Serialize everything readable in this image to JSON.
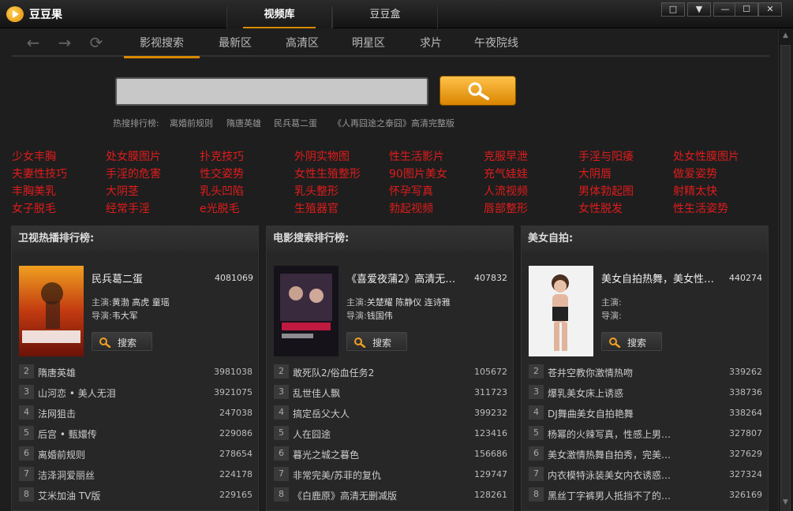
{
  "app": {
    "title": "豆豆果"
  },
  "top_tabs": [
    {
      "label": "视频库",
      "active": true
    },
    {
      "label": "豆豆盒",
      "active": false
    }
  ],
  "window_controls": {
    "skin": "□",
    "menu": "▼",
    "minimize": "—",
    "maximize": "☐",
    "close": "✕"
  },
  "nav": {
    "back": "←",
    "forward": "→",
    "refresh": "⟳",
    "tabs": [
      {
        "label": "影视搜索",
        "active": true
      },
      {
        "label": "最新区"
      },
      {
        "label": "高清区"
      },
      {
        "label": "明星区"
      },
      {
        "label": "求片"
      },
      {
        "label": "午夜院线"
      }
    ]
  },
  "search": {
    "value": "",
    "placeholder": ""
  },
  "hot_search": {
    "label": "热搜排行榜:",
    "items": [
      "离婚前规则",
      "隋唐英雄",
      "民兵葛二蛋",
      "《人再囧途之泰囧》高清完整版"
    ]
  },
  "tags": [
    [
      "少女丰胸",
      "处女膜图片",
      "扑克技巧",
      "外阴实物图",
      "性生活影片",
      "克服早泄",
      "手淫与阳痿",
      "处女性膜图片"
    ],
    [
      "夫妻性技巧",
      "手淫的危害",
      "性交姿势",
      "女性生殖整形",
      "90图片美女",
      "充气娃娃",
      "大阴唇",
      "做爱姿势"
    ],
    [
      "丰胸美乳",
      "大阴茎",
      "乳头凹陷",
      "乳头整形",
      "怀孕写真",
      "人流视频",
      "男体勃起图",
      "射精太快"
    ],
    [
      "女子脱毛",
      "经常手淫",
      "e光脱毛",
      "生殖器官",
      "勃起视频",
      "唇部整形",
      "女性脱发",
      "性生活姿势"
    ]
  ],
  "panels": [
    {
      "header": "卫视热播排行榜:",
      "featured": {
        "title": "民兵葛二蛋",
        "count": "4081069",
        "cast_label": "主演:",
        "cast": "黄渤  高虎  童瑶",
        "director_label": "导演:",
        "director": "韦大军",
        "search_label": "搜索"
      },
      "rows": [
        {
          "rank": "2",
          "title": "隋唐英雄",
          "count": "3981038"
        },
        {
          "rank": "3",
          "title": "山河恋 • 美人无泪",
          "count": "3921075"
        },
        {
          "rank": "4",
          "title": "法网狙击",
          "count": "247038"
        },
        {
          "rank": "5",
          "title": "后宫 • 甄嬛传",
          "count": "229086"
        },
        {
          "rank": "6",
          "title": "离婚前规则",
          "count": "278654"
        },
        {
          "rank": "7",
          "title": "洁泽洞爱丽丝",
          "count": "224178"
        },
        {
          "rank": "8",
          "title": "艾米加油  TV版",
          "count": "229165"
        }
      ]
    },
    {
      "header": "电影搜索排行榜:",
      "featured": {
        "title": "《喜爱夜蒲2》高清无…",
        "count": "407832",
        "cast_label": "主演:",
        "cast": "关楚耀  陈静仪  连诗雅",
        "director_label": "导演:",
        "director": "钱国伟",
        "search_label": "搜索"
      },
      "rows": [
        {
          "rank": "2",
          "title": "敢死队2/俗血任务2",
          "count": "105672"
        },
        {
          "rank": "3",
          "title": "乱世佳人飘",
          "count": "311723"
        },
        {
          "rank": "4",
          "title": "搞定岳父大人",
          "count": "399232"
        },
        {
          "rank": "5",
          "title": "人在囧途",
          "count": "123416"
        },
        {
          "rank": "6",
          "title": "暮光之城之暮色",
          "count": "156686"
        },
        {
          "rank": "7",
          "title": "非常完美/苏菲的复仇",
          "count": "129747"
        },
        {
          "rank": "8",
          "title": "《白鹿原》高清无删减版",
          "count": "128261"
        }
      ]
    },
    {
      "header": "美女自拍:",
      "featured": {
        "title": "美女自拍热舞，美女性…",
        "count": "440274",
        "cast_label": "主演:",
        "cast": "",
        "director_label": "导演:",
        "director": "",
        "search_label": "搜索"
      },
      "rows": [
        {
          "rank": "2",
          "title": "苍井空教你激情热吻",
          "count": "339262"
        },
        {
          "rank": "3",
          "title": "爆乳美女床上诱惑",
          "count": "338736"
        },
        {
          "rank": "4",
          "title": "DJ舞曲美女自拍艳舞",
          "count": "338264"
        },
        {
          "rank": "5",
          "title": "杨幂的火辣写真，性感上男…",
          "count": "327807"
        },
        {
          "rank": "6",
          "title": "美女激情热舞自拍秀，完美…",
          "count": "327629"
        },
        {
          "rank": "7",
          "title": "内衣模特泳装美女内衣诱惑…",
          "count": "327324"
        },
        {
          "rank": "8",
          "title": "黑丝丁字裤男人抵挡不了的…",
          "count": "326169"
        }
      ]
    }
  ]
}
